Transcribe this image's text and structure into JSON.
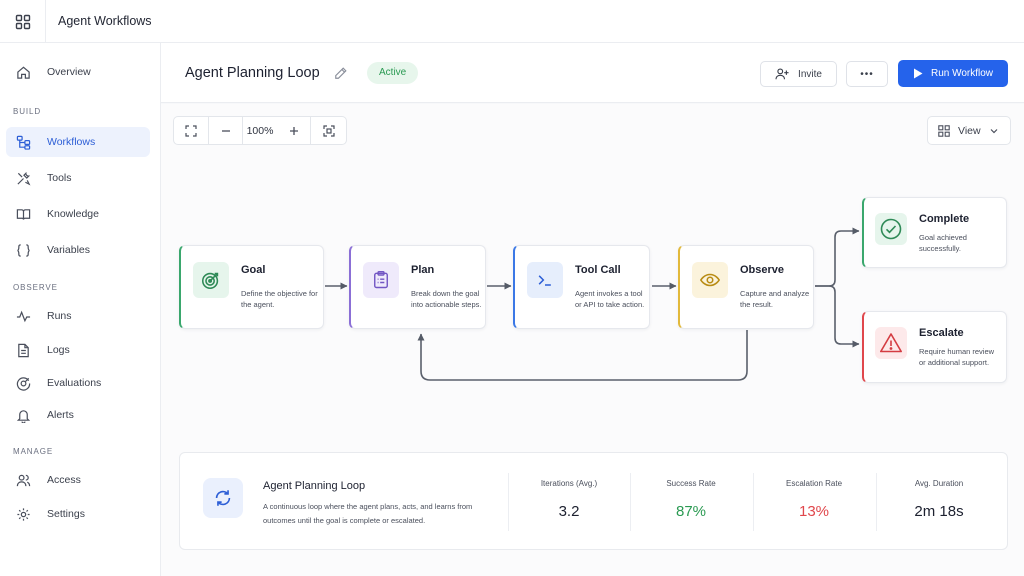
{
  "app": {
    "title": "Agent Workflows"
  },
  "sidebar": {
    "top_item": {
      "label": "Overview",
      "icon": "home-icon"
    },
    "sections": [
      {
        "label": "BUILD",
        "items": [
          {
            "label": "Workflows",
            "icon": "workflow-icon",
            "active": true
          },
          {
            "label": "Tools",
            "icon": "tools-icon"
          },
          {
            "label": "Knowledge",
            "icon": "book-icon"
          },
          {
            "label": "Variables",
            "icon": "braces-icon"
          }
        ]
      },
      {
        "label": "OBSERVE",
        "items": [
          {
            "label": "Runs",
            "icon": "activity-icon"
          },
          {
            "label": "Logs",
            "icon": "document-icon"
          },
          {
            "label": "Evaluations",
            "icon": "gauge-icon"
          },
          {
            "label": "Alerts",
            "icon": "bell-icon"
          }
        ]
      },
      {
        "label": "MANAGE",
        "items": [
          {
            "label": "Access",
            "icon": "users-icon"
          },
          {
            "label": "Settings",
            "icon": "gear-icon"
          }
        ]
      }
    ]
  },
  "header": {
    "workflow_title": "Agent Planning Loop",
    "status": "Active",
    "invite_label": "Invite",
    "more_label": "•••",
    "run_label": "Run Workflow"
  },
  "canvas": {
    "zoom": "100%",
    "view_label": "View",
    "nodes": [
      {
        "title": "Goal",
        "description": "Define the objective for the agent.",
        "icon": "target-icon",
        "accent": "#3aa76d",
        "tint": "#e6f5ec"
      },
      {
        "title": "Plan",
        "description": "Break down the goal into actionable steps.",
        "icon": "clipboard-icon",
        "accent": "#8b6fd6",
        "tint": "#efeafb"
      },
      {
        "title": "Tool Call",
        "description": "Agent invokes a tool or API to take action.",
        "icon": "terminal-icon",
        "accent": "#3b78e6",
        "tint": "#e6eefc"
      },
      {
        "title": "Observe",
        "description": "Capture and analyze the result.",
        "icon": "eye-icon",
        "accent": "#e2b93b",
        "tint": "#fbf3dc"
      }
    ],
    "outcomes": [
      {
        "title": "Complete",
        "description": "Goal achieved successfully.",
        "icon": "check-circle-icon",
        "accent": "#3aa76d",
        "tint": "#e6f5ec"
      },
      {
        "title": "Escalate",
        "description": "Require human review or additional support.",
        "icon": "warning-icon",
        "accent": "#e0474c",
        "tint": "#fde9ea"
      }
    ]
  },
  "summary": {
    "title": "Agent Planning Loop",
    "description": "A continuous loop where the agent plans, acts, and learns from outcomes until the goal is complete or escalated.",
    "metrics": [
      {
        "label": "Iterations (Avg.)",
        "value": "3.2",
        "color": "#1d2130"
      },
      {
        "label": "Success Rate",
        "value": "87%",
        "color": "#2a9a52"
      },
      {
        "label": "Escalation Rate",
        "value": "13%",
        "color": "#e0474c"
      },
      {
        "label": "Avg. Duration",
        "value": "2m 18s",
        "color": "#1d2130"
      }
    ]
  }
}
